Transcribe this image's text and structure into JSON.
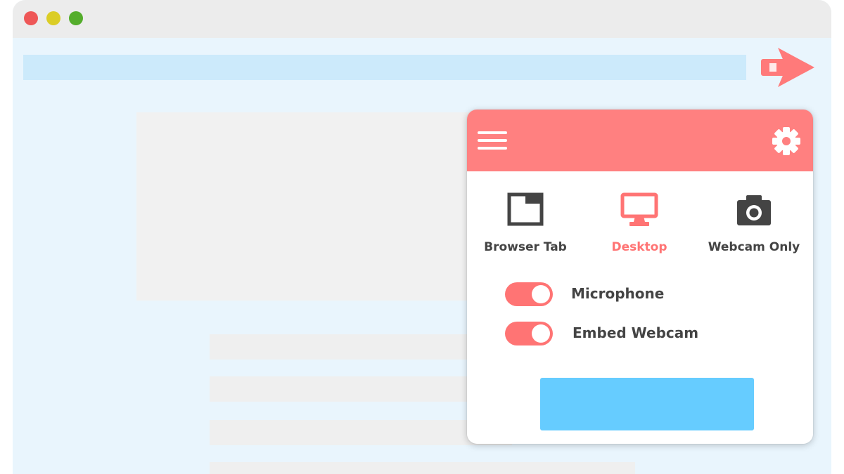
{
  "window": {
    "controls": [
      "close",
      "minimize",
      "maximize"
    ]
  },
  "extension": {
    "logo_icon": "play-camera-logo-icon",
    "accent_color": "#ff8080"
  },
  "popup": {
    "header": {
      "menu_icon": "hamburger-menu-icon",
      "settings_icon": "gear-icon",
      "color": "#ff8080"
    },
    "modes": [
      {
        "label": "Browser Tab",
        "icon": "browser-tab-icon",
        "selected": false
      },
      {
        "label": "Desktop",
        "icon": "monitor-icon",
        "selected": true
      },
      {
        "label": "Webcam Only",
        "icon": "camera-icon",
        "selected": false
      }
    ],
    "toggles": [
      {
        "label": "Microphone",
        "on": true
      },
      {
        "label": "Embed Webcam",
        "on": true
      }
    ],
    "start_button": {
      "label": "",
      "color": "#66ccff"
    }
  }
}
